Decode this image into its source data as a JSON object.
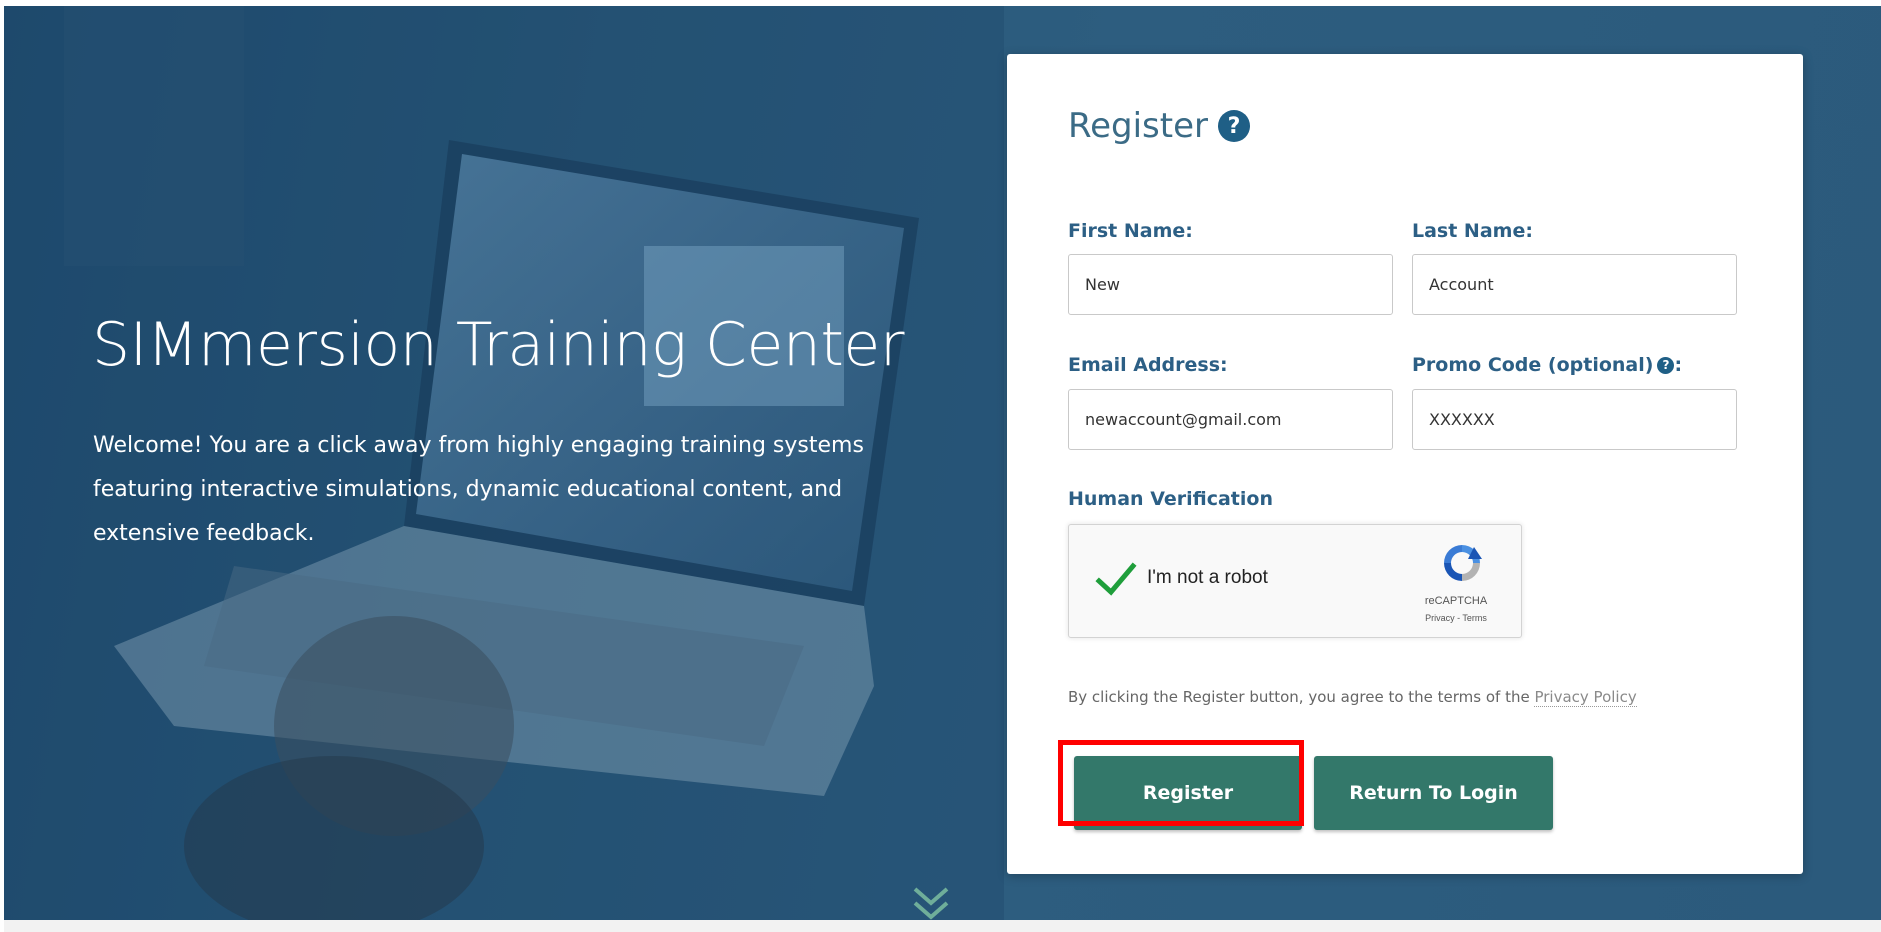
{
  "hero": {
    "title": "SIMmersion Training Center",
    "description": "Welcome! You are a click away from highly engaging training systems featuring interactive simulations, dynamic educational content, and extensive feedback."
  },
  "form": {
    "title": "Register",
    "first_name": {
      "label": "First Name:",
      "value": "New"
    },
    "last_name": {
      "label": "Last Name:",
      "value": "Account"
    },
    "email": {
      "label": "Email Address:",
      "value": "newaccount@gmail.com"
    },
    "promo": {
      "label": "Promo Code (optional)",
      "label_suffix": ":",
      "value": "XXXXXX"
    },
    "verification_label": "Human Verification",
    "captcha": {
      "text": "I'm not a robot",
      "brand": "reCAPTCHA",
      "links": "Privacy - Terms",
      "checked": true
    },
    "terms": {
      "text": "By clicking the Register button, you agree to the terms of the ",
      "link": "Privacy Policy"
    },
    "register_button": "Register",
    "return_button": "Return To Login"
  },
  "colors": {
    "accent_blue": "#2c5f85",
    "button_green": "#33786a",
    "highlight": "#ff0000"
  },
  "icons": [
    "help-icon",
    "checkmark-icon",
    "recaptcha-icon",
    "double-chevron-down-icon"
  ]
}
